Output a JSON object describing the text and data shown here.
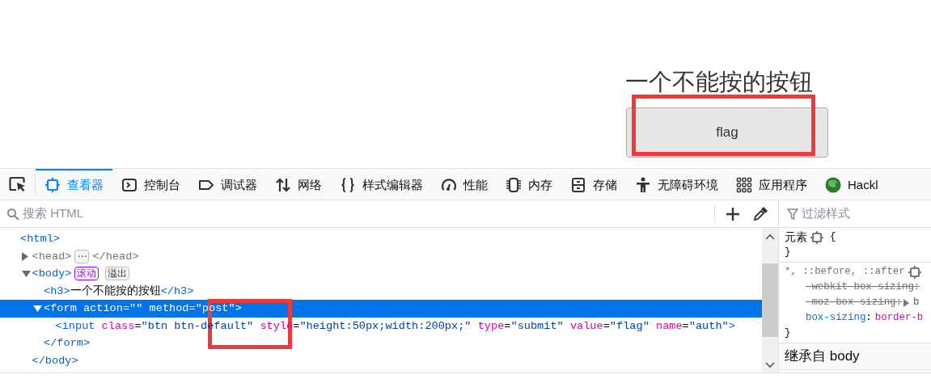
{
  "page": {
    "heading": "一个不能按的按钮",
    "button": "flag"
  },
  "toolbar": {
    "tabs": [
      {
        "label": "查看器",
        "selected": true
      },
      {
        "label": "控制台",
        "selected": false
      },
      {
        "label": "调试器",
        "selected": false
      },
      {
        "label": "网络",
        "selected": false
      },
      {
        "label": "样式编辑器",
        "selected": false
      },
      {
        "label": "性能",
        "selected": false
      },
      {
        "label": "内存",
        "selected": false
      },
      {
        "label": "存储",
        "selected": false
      },
      {
        "label": "无障碍环境",
        "selected": false
      },
      {
        "label": "应用程序",
        "selected": false
      },
      {
        "label": "Hackl",
        "selected": false
      }
    ]
  },
  "markup_search": {
    "placeholder": "搜索 HTML"
  },
  "tree": [
    {
      "tokens": [
        {
          "kind": "tag",
          "text": "<html>"
        }
      ],
      "selected": false,
      "children": [
        {
          "tokens": [
            {
              "kind": "muted",
              "text": "<head>"
            }
          ],
          "expanded": false,
          "selected": false,
          "badges": [
            {
              "kind": "ellipsis",
              "text": "⋯"
            }
          ],
          "close": [
            {
              "kind": "muted",
              "text": "</head>"
            }
          ]
        },
        {
          "tokens": [
            {
              "kind": "tag",
              "text": "<body>"
            }
          ],
          "expanded": true,
          "selected": false,
          "badges": [
            {
              "kind": "scroll",
              "text": "滚动"
            },
            {
              "kind": "plain",
              "text": "溢出"
            }
          ],
          "children": [
            {
              "tokens": [
                {
                  "kind": "tag",
                  "text": "<h3>"
                },
                {
                  "kind": "text",
                  "text": "一个不能按的按钮"
                },
                {
                  "kind": "tag",
                  "text": "</h3>"
                }
              ],
              "selected": false
            },
            {
              "tokens": [
                {
                  "kind": "tag",
                  "text": "<form "
                },
                {
                  "kind": "attr",
                  "text": "action"
                },
                {
                  "kind": "text",
                  "text": "="
                },
                {
                  "kind": "value",
                  "text": "\"\" "
                },
                {
                  "kind": "attr",
                  "text": "method"
                },
                {
                  "kind": "text",
                  "text": "="
                },
                {
                  "kind": "value",
                  "text": "\"post\""
                },
                {
                  "kind": "tag",
                  "text": ">"
                }
              ],
              "expanded": true,
              "selected": true,
              "children": [
                {
                  "tokens": [
                    {
                      "kind": "tag",
                      "text": "<input "
                    },
                    {
                      "kind": "attr",
                      "text": "class"
                    },
                    {
                      "kind": "text",
                      "text": "="
                    },
                    {
                      "kind": "value",
                      "text": "\"btn btn-default\" "
                    },
                    {
                      "kind": "attr",
                      "text": "style"
                    },
                    {
                      "kind": "text",
                      "text": "="
                    },
                    {
                      "kind": "value",
                      "text": "\"height:50px;width:200px;\" "
                    },
                    {
                      "kind": "attr",
                      "text": "type"
                    },
                    {
                      "kind": "text",
                      "text": "="
                    },
                    {
                      "kind": "value",
                      "text": "\"submit\" "
                    },
                    {
                      "kind": "attr",
                      "text": "value"
                    },
                    {
                      "kind": "text",
                      "text": "="
                    },
                    {
                      "kind": "value",
                      "text": "\"flag\" "
                    },
                    {
                      "kind": "attr",
                      "text": "name"
                    },
                    {
                      "kind": "text",
                      "text": "="
                    },
                    {
                      "kind": "value",
                      "text": "\"auth\""
                    },
                    {
                      "kind": "tag",
                      "text": ">"
                    }
                  ],
                  "selected": false
                }
              ],
              "close": [
                {
                  "kind": "tag",
                  "text": "</form>"
                }
              ]
            }
          ],
          "close": [
            {
              "kind": "tag",
              "text": "</body>"
            }
          ]
        }
      ]
    }
  ],
  "rules_filter": {
    "placeholder": "过滤样式"
  },
  "rules": [
    {
      "selector": "元素",
      "open": "{",
      "close": "}"
    },
    {
      "selector": "*, ::before, ::after",
      "declarations": [
        {
          "property": "-webkit-box-sizing:",
          "overridden": true
        },
        {
          "property": "-moz-box-sizing:",
          "value": "b",
          "overridden": true
        },
        {
          "property": "box-sizing",
          "separator": ":",
          "value": "border-b",
          "overridden": false
        }
      ],
      "close": "}"
    }
  ],
  "inherited_header": "继承自 body",
  "annotations": [
    {
      "kind": "rectangle"
    },
    {
      "kind": "rectangle"
    }
  ]
}
